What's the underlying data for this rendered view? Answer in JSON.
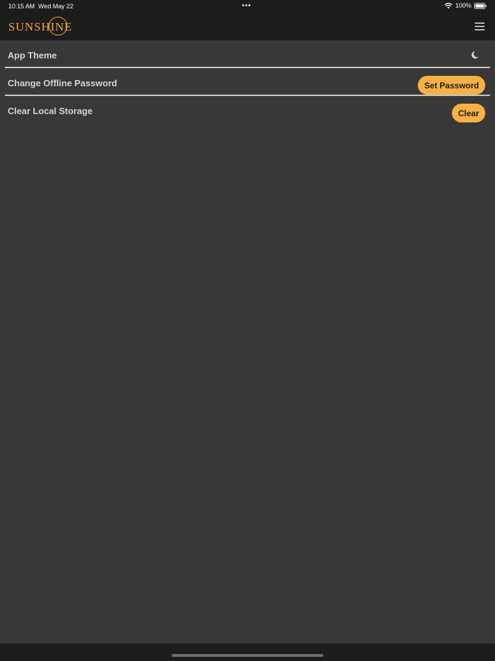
{
  "status_bar": {
    "time": "10:15 AM",
    "date": "Wed May 22",
    "dots": "•••",
    "battery": "100%"
  },
  "header": {
    "logo": "SUNSHINE",
    "brand_color": "#f2a93b",
    "menu_icon": "hamburger-menu-icon"
  },
  "settings": {
    "theme_label": "App Theme",
    "theme_icon": "moon-icon",
    "password_label": "Change Offline Password",
    "password_button": "Set Password",
    "storage_label": "Clear Local Storage",
    "storage_button": "Clear"
  },
  "colors": {
    "background": "#383838",
    "bar": "#1c1c1c",
    "accent_button": "#f7b045",
    "label_text": "#d3d3d3"
  }
}
